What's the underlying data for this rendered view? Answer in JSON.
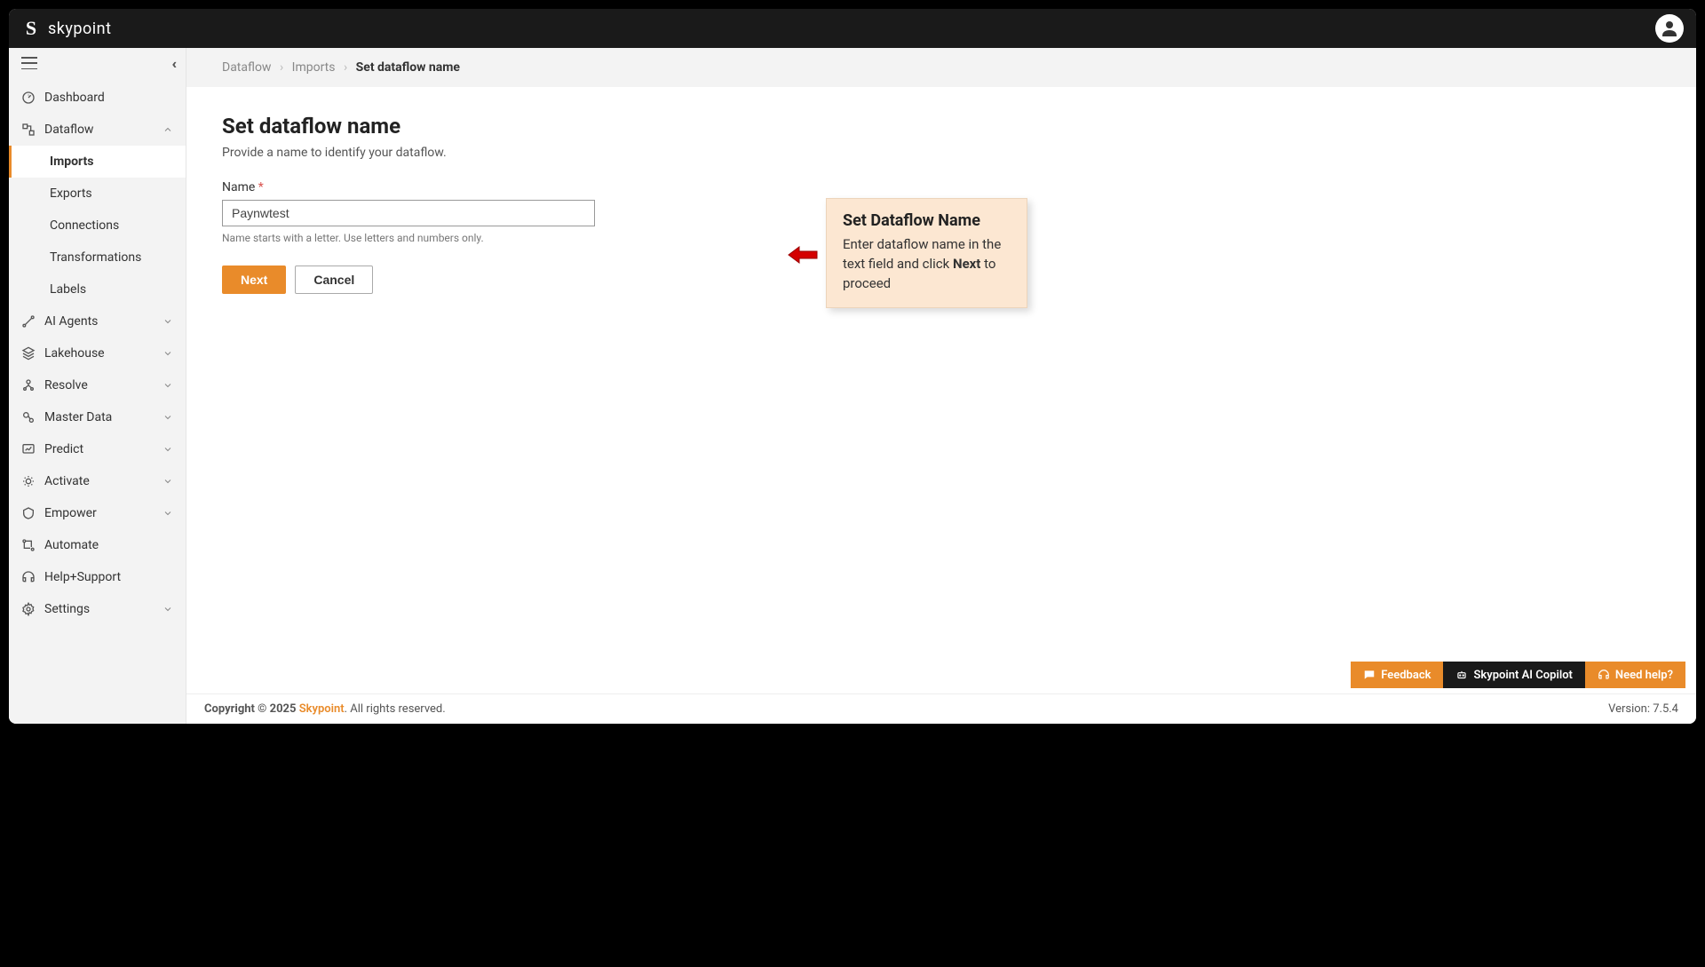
{
  "brand": {
    "name": "skypoint"
  },
  "sidebar": {
    "items": [
      {
        "label": "Dashboard"
      },
      {
        "label": "Dataflow",
        "expanded": true,
        "children": [
          {
            "label": "Imports",
            "active": true
          },
          {
            "label": "Exports"
          },
          {
            "label": "Connections"
          },
          {
            "label": "Transformations"
          },
          {
            "label": "Labels"
          }
        ]
      },
      {
        "label": "AI Agents",
        "expandable": true
      },
      {
        "label": "Lakehouse",
        "expandable": true
      },
      {
        "label": "Resolve",
        "expandable": true
      },
      {
        "label": "Master Data",
        "expandable": true
      },
      {
        "label": "Predict",
        "expandable": true
      },
      {
        "label": "Activate",
        "expandable": true
      },
      {
        "label": "Empower",
        "expandable": true
      },
      {
        "label": "Automate"
      },
      {
        "label": "Help+Support"
      },
      {
        "label": "Settings",
        "expandable": true
      }
    ]
  },
  "breadcrumb": {
    "items": [
      "Dataflow",
      "Imports"
    ],
    "current": "Set dataflow name"
  },
  "page": {
    "title": "Set dataflow name",
    "description": "Provide a name to identify your dataflow.",
    "name_label": "Name",
    "name_value": "Paynwtest",
    "hint": "Name starts with a letter. Use letters and numbers only.",
    "next": "Next",
    "cancel": "Cancel"
  },
  "callout": {
    "title": "Set Dataflow Name",
    "text_pre": "Enter dataflow name in the text field and click ",
    "text_bold": "Next",
    "text_post": " to proceed"
  },
  "bottom": {
    "feedback": "Feedback",
    "copilot": "Skypoint AI Copilot",
    "help": "Need help?"
  },
  "footer": {
    "copyright_pre": "Copyright © 2025 ",
    "brand": "Skypoint",
    "copyright_post": ". All rights reserved.",
    "version": "Version: 7.5.4"
  }
}
